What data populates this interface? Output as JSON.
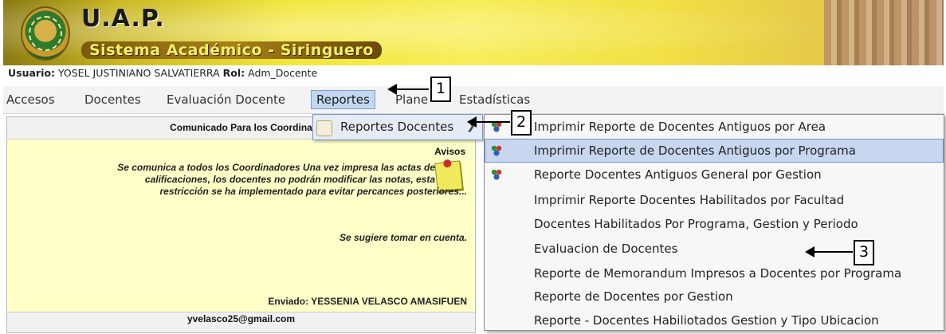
{
  "header": {
    "title": "U.A.P.",
    "subtitle": "Sistema Académico - Siringuero"
  },
  "user": {
    "user_label": "Usuario:",
    "user_name": "YOSEL JUSTINIANO SALVATIERRA",
    "role_label": "Rol:",
    "role": "Adm_Docente"
  },
  "menu": {
    "items": [
      "Accesos",
      "Docentes",
      "Evaluación Docente",
      "Reportes",
      "Plane",
      "Estadísticas"
    ],
    "active": "Reportes"
  },
  "panel": {
    "header": "Comunicado Para los Coordina",
    "avisos": "Avisos",
    "message_line1": "Se comunica a todos los Coordinadores Una vez impresa las actas de",
    "message_line2": "calificaciones, los docentes no podrán modificar las notas, esta",
    "message_line3": "restricción se ha implementado para evitar percances posteriores...",
    "suggestion": "Se sugiere tomar en cuenta.",
    "sent_by": "Enviado: YESSENIA VELASCO AMASIFUEN",
    "email": "yvelasco25@gmail.com"
  },
  "submenu": {
    "label": "Reportes Docentes",
    "icon": "document-icon"
  },
  "dropdown": {
    "items": [
      {
        "label": "Imprimir Reporte de Docentes Antiguos por Area",
        "icon": "people-icon"
      },
      {
        "label": "Imprimir Reporte de Docentes Antiguos por Programa",
        "icon": "people-icon"
      },
      {
        "label": "Reporte Docentes Antiguos General por Gestion",
        "icon": "people-icon"
      },
      {
        "label": "Imprimir Reporte Docentes Habilitados por Facultad",
        "icon": ""
      },
      {
        "label": "Docentes Habilitados Por Programa, Gestion y Periodo",
        "icon": ""
      },
      {
        "label": "Evaluacion de Docentes",
        "icon": ""
      },
      {
        "label": "Reporte de Memorandum Impresos a Docentes por Programa",
        "icon": ""
      },
      {
        "label": "Reporte de Docentes por Gestion",
        "icon": ""
      },
      {
        "label": "Reporte - Docentes Habiliotados Gestion y Tipo Ubicacion",
        "icon": ""
      }
    ],
    "highlighted": "Imprimir Reporte de Docentes Antiguos por Programa"
  },
  "callouts": [
    "1",
    "2",
    "3"
  ],
  "colors": {
    "menu_active_bg": "#c4d7f0",
    "notice_bg": "#ffffc8",
    "highlight_bg": "#c8d7ef"
  }
}
